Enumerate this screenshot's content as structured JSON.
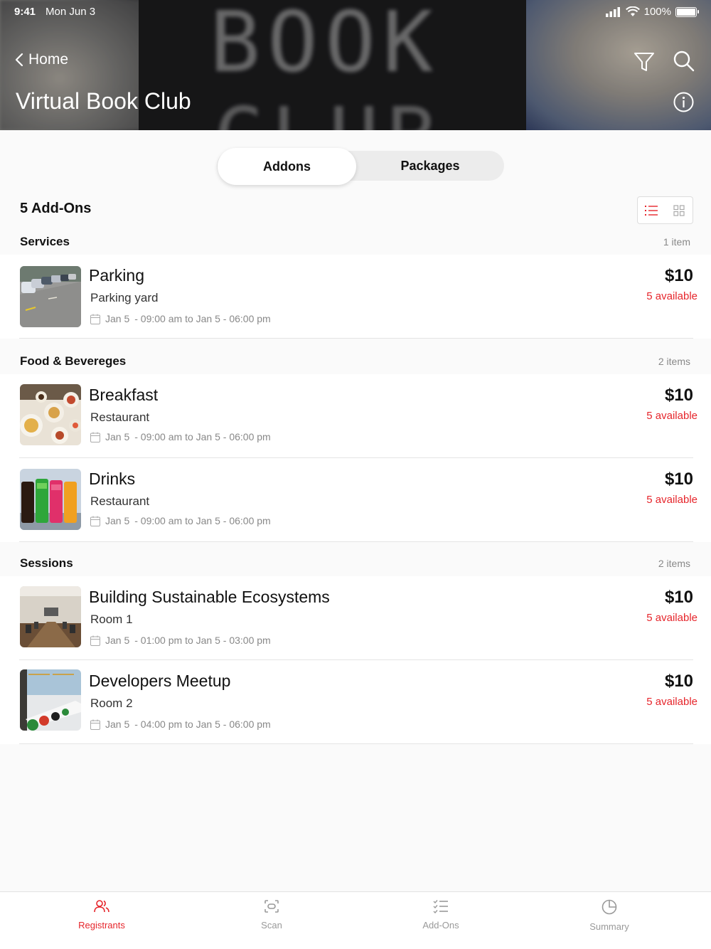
{
  "status_bar": {
    "time": "9:41",
    "date": "Mon Jun 3",
    "battery": "100%"
  },
  "header": {
    "back_label": "Home",
    "title": "Virtual Book Club",
    "bg_text_top": "BOOK",
    "bg_text_bottom": "CLUB"
  },
  "segments": {
    "active": "Addons",
    "inactive": "Packages"
  },
  "list_header": {
    "count_title": "5 Add-Ons"
  },
  "sections": [
    {
      "name": "Services",
      "count": "1 item"
    },
    {
      "name": "Food & Bevereges",
      "count": "2 items"
    },
    {
      "name": "Sessions",
      "count": "2 items"
    }
  ],
  "items": [
    {
      "name": "Parking",
      "subtitle": "Parking yard",
      "date_start": "Jan 5",
      "date_range": "- 09:00 am to Jan 5 - 06:00 pm",
      "price": "$10",
      "availability": "5 available"
    },
    {
      "name": "Breakfast",
      "subtitle": "Restaurant",
      "date_start": "Jan 5",
      "date_range": "- 09:00 am to Jan 5 - 06:00 pm",
      "price": "$10",
      "availability": "5 available"
    },
    {
      "name": "Drinks",
      "subtitle": "Restaurant",
      "date_start": "Jan 5",
      "date_range": "- 09:00 am to Jan 5 - 06:00 pm",
      "price": "$10",
      "availability": "5 available"
    },
    {
      "name": "Building Sustainable Ecosystems",
      "subtitle": "Room 1",
      "date_start": "Jan 5",
      "date_range": "- 01:00 pm to Jan 5 - 03:00 pm",
      "price": "$10",
      "availability": "5 available"
    },
    {
      "name": "Developers Meetup",
      "subtitle": "Room 2",
      "date_start": "Jan 5",
      "date_range": "- 04:00 pm to Jan 5 - 06:00 pm",
      "price": "$10",
      "availability": "5 available"
    }
  ],
  "tabbar": [
    {
      "label": "Registrants",
      "icon": "people-icon",
      "active": true
    },
    {
      "label": "Scan",
      "icon": "scan-icon",
      "active": false
    },
    {
      "label": "Add-Ons",
      "icon": "checklist-icon",
      "active": false
    },
    {
      "label": "Summary",
      "icon": "pie-chart-icon",
      "active": false
    }
  ],
  "colors": {
    "accent": "#e6252b",
    "muted": "#888888",
    "background": "#fafafa"
  }
}
